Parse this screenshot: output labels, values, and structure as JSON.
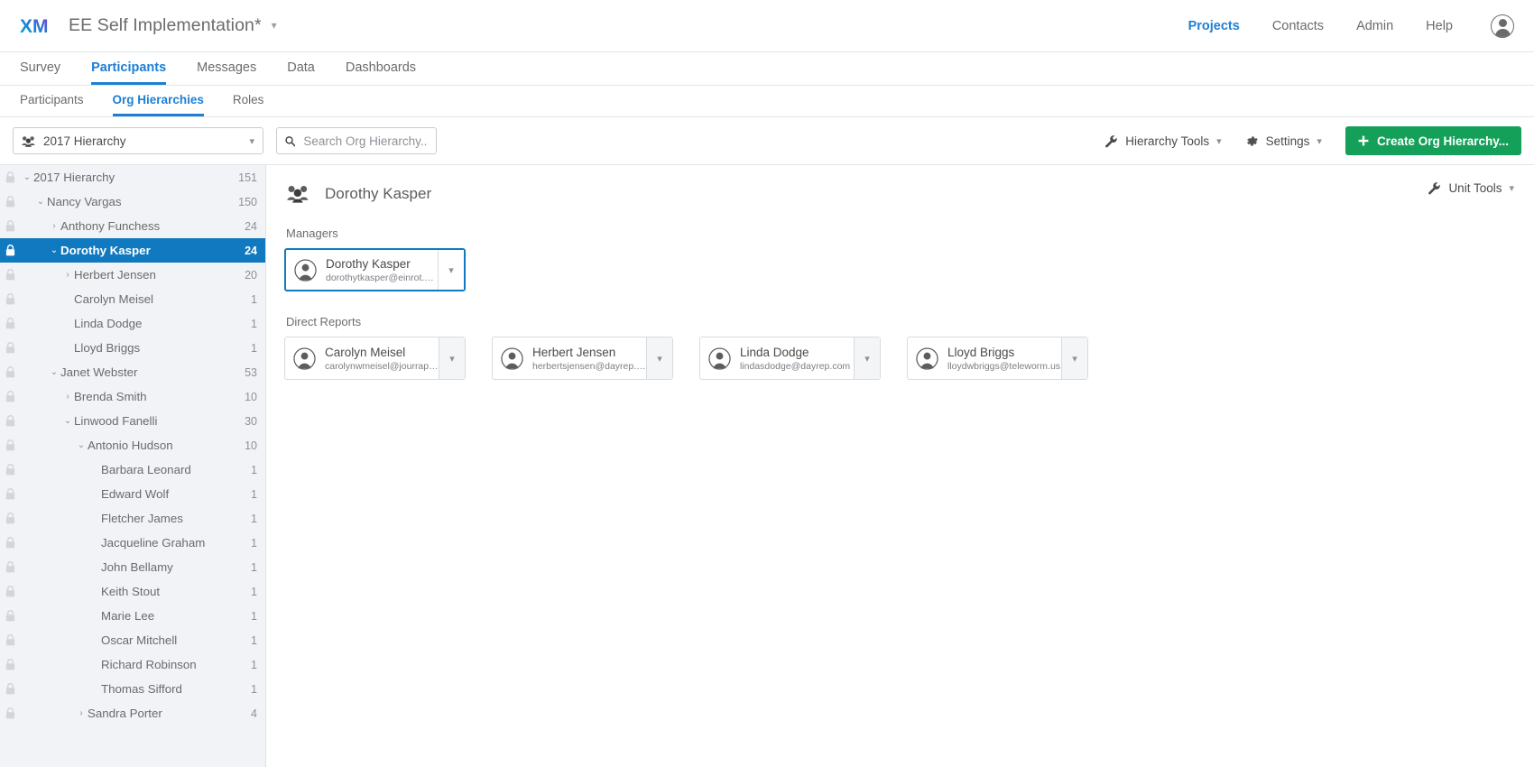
{
  "brand": {
    "logo_text": "XM",
    "accent_blue": "#1d7fd4",
    "accent_green": "#15a05a",
    "selected_blue": "#1179bf"
  },
  "topbar": {
    "project_title": "EE Self Implementation*",
    "project_caret": "⌄",
    "nav": [
      {
        "label": "Projects",
        "active": true
      },
      {
        "label": "Contacts",
        "active": false
      },
      {
        "label": "Admin",
        "active": false
      },
      {
        "label": "Help",
        "active": false
      }
    ],
    "avatar_name": "account-avatar"
  },
  "tabs_primary": [
    {
      "label": "Survey",
      "active": false
    },
    {
      "label": "Participants",
      "active": true
    },
    {
      "label": "Messages",
      "active": false
    },
    {
      "label": "Data",
      "active": false
    },
    {
      "label": "Dashboards",
      "active": false
    }
  ],
  "tabs_secondary": [
    {
      "label": "Participants",
      "active": false
    },
    {
      "label": "Org Hierarchies",
      "active": true
    },
    {
      "label": "Roles",
      "active": false
    }
  ],
  "toolbar": {
    "hierarchy_select_value": "2017 Hierarchy",
    "search_placeholder": "Search Org Hierarchy...",
    "search_value": "",
    "hierarchy_tools_label": "Hierarchy Tools",
    "settings_label": "Settings",
    "create_button_label": "Create Org Hierarchy..."
  },
  "sidebar": {
    "rows": [
      {
        "name": "2017 Hierarchy",
        "count": "151",
        "depth": 0,
        "chevron": "down",
        "selected": false
      },
      {
        "name": "Nancy Vargas",
        "count": "150",
        "depth": 1,
        "chevron": "down",
        "selected": false
      },
      {
        "name": "Anthony Funchess",
        "count": "24",
        "depth": 2,
        "chevron": "right",
        "selected": false
      },
      {
        "name": "Dorothy Kasper",
        "count": "24",
        "depth": 2,
        "chevron": "down",
        "selected": true
      },
      {
        "name": "Herbert Jensen",
        "count": "20",
        "depth": 3,
        "chevron": "right",
        "selected": false
      },
      {
        "name": "Carolyn Meisel",
        "count": "1",
        "depth": 3,
        "chevron": "none",
        "selected": false
      },
      {
        "name": "Linda Dodge",
        "count": "1",
        "depth": 3,
        "chevron": "none",
        "selected": false
      },
      {
        "name": "Lloyd Briggs",
        "count": "1",
        "depth": 3,
        "chevron": "none",
        "selected": false
      },
      {
        "name": "Janet Webster",
        "count": "53",
        "depth": 2,
        "chevron": "down",
        "selected": false
      },
      {
        "name": "Brenda Smith",
        "count": "10",
        "depth": 3,
        "chevron": "right",
        "selected": false
      },
      {
        "name": "Linwood Fanelli",
        "count": "30",
        "depth": 3,
        "chevron": "down",
        "selected": false
      },
      {
        "name": "Antonio Hudson",
        "count": "10",
        "depth": 4,
        "chevron": "down",
        "selected": false
      },
      {
        "name": "Barbara Leonard",
        "count": "1",
        "depth": 5,
        "chevron": "none",
        "selected": false
      },
      {
        "name": "Edward Wolf",
        "count": "1",
        "depth": 5,
        "chevron": "none",
        "selected": false
      },
      {
        "name": "Fletcher James",
        "count": "1",
        "depth": 5,
        "chevron": "none",
        "selected": false
      },
      {
        "name": "Jacqueline Graham",
        "count": "1",
        "depth": 5,
        "chevron": "none",
        "selected": false
      },
      {
        "name": "John Bellamy",
        "count": "1",
        "depth": 5,
        "chevron": "none",
        "selected": false
      },
      {
        "name": "Keith Stout",
        "count": "1",
        "depth": 5,
        "chevron": "none",
        "selected": false
      },
      {
        "name": "Marie Lee",
        "count": "1",
        "depth": 5,
        "chevron": "none",
        "selected": false
      },
      {
        "name": "Oscar Mitchell",
        "count": "1",
        "depth": 5,
        "chevron": "none",
        "selected": false
      },
      {
        "name": "Richard Robinson",
        "count": "1",
        "depth": 5,
        "chevron": "none",
        "selected": false
      },
      {
        "name": "Thomas Sifford",
        "count": "1",
        "depth": 5,
        "chevron": "none",
        "selected": false
      },
      {
        "name": "Sandra Porter",
        "count": "4",
        "depth": 4,
        "chevron": "right",
        "selected": false
      }
    ]
  },
  "content": {
    "unit_title": "Dorothy Kasper",
    "unit_tools_label": "Unit Tools",
    "managers_label": "Managers",
    "direct_reports_label": "Direct Reports",
    "managers": [
      {
        "name": "Dorothy Kasper",
        "email": "dorothytkasper@einrot.com",
        "selected": true
      }
    ],
    "direct_reports": [
      {
        "name": "Carolyn Meisel",
        "email": "carolynwmeisel@jourrapide…",
        "selected": false
      },
      {
        "name": "Herbert Jensen",
        "email": "herbertsjensen@dayrep.com",
        "selected": false
      },
      {
        "name": "Linda Dodge",
        "email": "lindasdodge@dayrep.com",
        "selected": false
      },
      {
        "name": "Lloyd Briggs",
        "email": "lloydwbriggs@teleworm.us",
        "selected": false
      }
    ]
  }
}
